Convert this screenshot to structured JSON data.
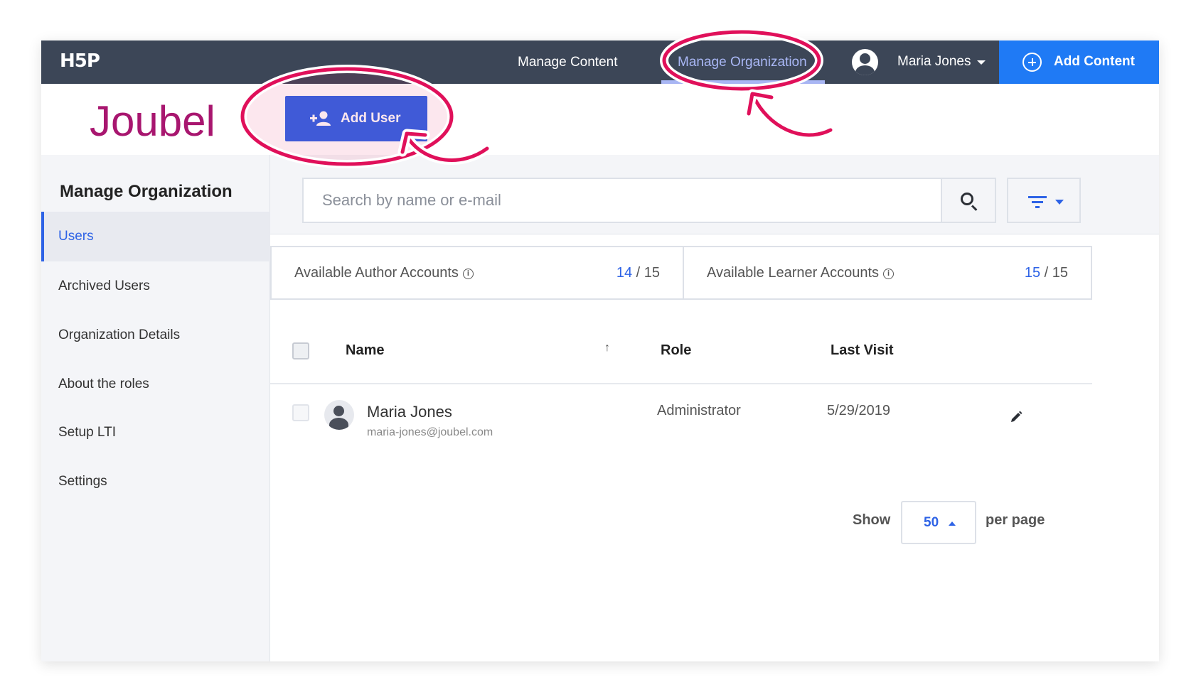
{
  "topnav": {
    "logo": "H5P",
    "manage_content": "Manage Content",
    "manage_organization": "Manage Organization",
    "user_name": "Maria Jones",
    "add_content": "Add Content"
  },
  "org": {
    "name": "Joubel",
    "add_user": "Add User"
  },
  "sidebar": {
    "title": "Manage Organization",
    "items": [
      {
        "label": "Users",
        "active": true
      },
      {
        "label": "Archived Users"
      },
      {
        "label": "Organization Details"
      },
      {
        "label": "About the roles"
      },
      {
        "label": "Setup LTI"
      },
      {
        "label": "Settings"
      }
    ]
  },
  "search": {
    "placeholder": "Search by name or e-mail"
  },
  "accounts": {
    "author_label": "Available Author Accounts",
    "author_used": "14",
    "author_total": "/ 15",
    "learner_label": "Available Learner Accounts",
    "learner_used": "15",
    "learner_total": "/ 15",
    "info_glyph": "i"
  },
  "table": {
    "headers": {
      "name": "Name",
      "role": "Role",
      "last_visit": "Last Visit"
    },
    "sort_glyph": "↑",
    "rows": [
      {
        "name": "Maria Jones",
        "email": "maria-jones@joubel.com",
        "role": "Administrator",
        "last_visit": "5/29/2019"
      }
    ]
  },
  "pagination": {
    "show": "Show",
    "per_page_value": "50",
    "per_page": "per page"
  },
  "colors": {
    "nav_bg": "#3c4657",
    "accent_blue": "#2e63e6",
    "add_content_blue": "#1f7af5",
    "org_name": "#a8166f",
    "annotation": "#e0105a"
  }
}
